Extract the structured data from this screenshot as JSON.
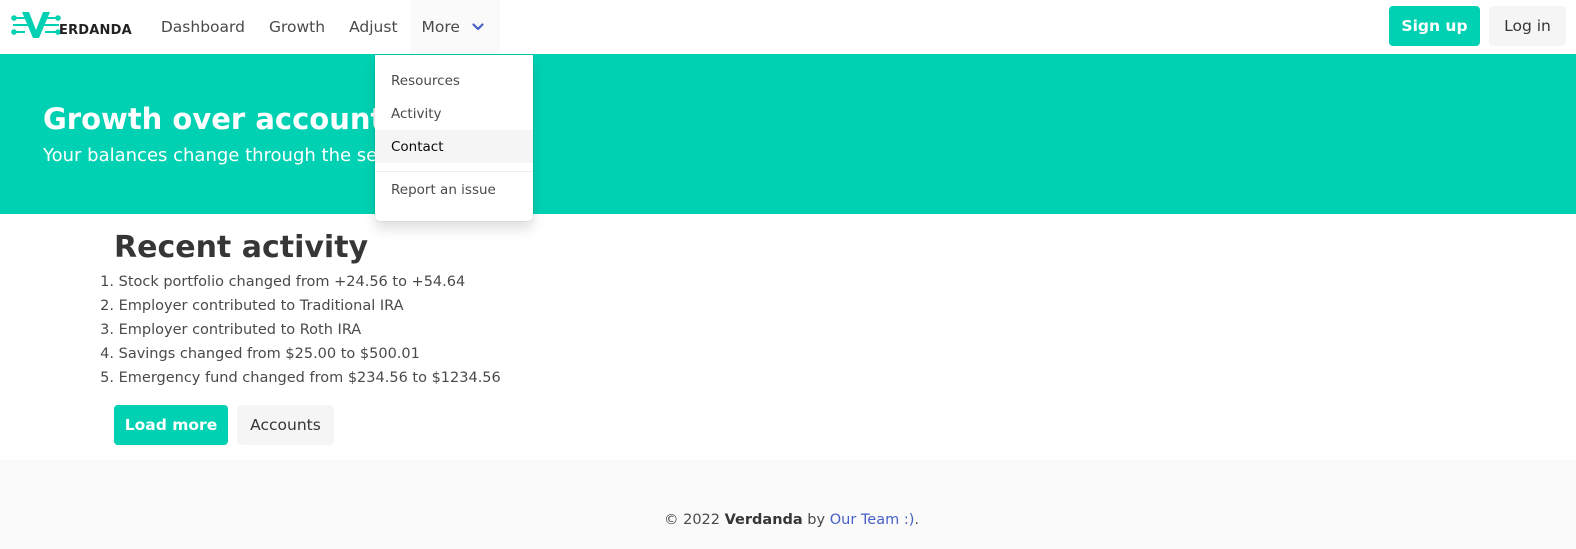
{
  "brand": {
    "name": "ERDANDA",
    "logo_letter": "V",
    "logo_icon": "circuit-v-logo-icon",
    "color": "#00d1b2"
  },
  "nav": {
    "items": [
      "Dashboard",
      "Growth",
      "Adjust"
    ],
    "more_label": "More",
    "more_icon": "chevron-down-icon"
  },
  "auth": {
    "signup_label": "Sign up",
    "login_label": "Log in"
  },
  "dropdown": {
    "items": [
      "Resources",
      "Activity",
      "Contact"
    ],
    "active_item": "Contact",
    "footer_item": "Report an issue"
  },
  "hero": {
    "title": "Growth over accounts.",
    "subtitle": "Your balances change through the sea"
  },
  "activity": {
    "title": "Recent activity",
    "items": [
      "Stock portfolio changed from +24.56 to +54.64",
      "Employer contributed to Traditional IRA",
      "Employer contributed to Roth IRA",
      "Savings changed from $25.00 to $500.01",
      "Emergency fund changed from $234.56 to $1234.56"
    ],
    "load_more_label": "Load more",
    "accounts_label": "Accounts"
  },
  "footer": {
    "copyright": "© 2022 ",
    "brand": "Verdanda",
    "by": " by ",
    "team_link": "Our Team :)",
    "end": "."
  },
  "colors": {
    "accent": "#00d1b2",
    "link": "#485fc7",
    "footer_bg": "#fafafa"
  }
}
